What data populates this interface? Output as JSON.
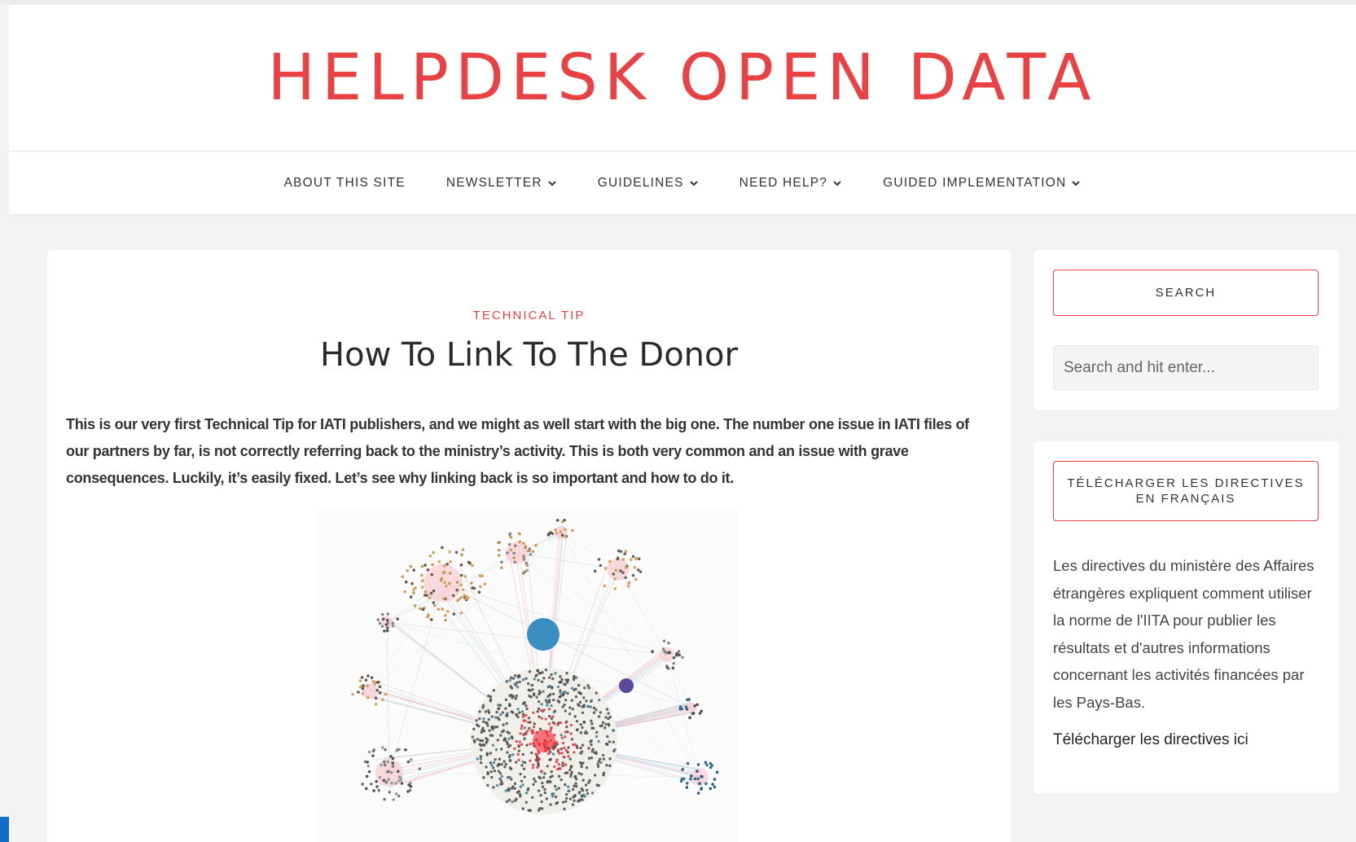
{
  "site": {
    "title": "HELPDESK OPEN DATA",
    "accent_color": "#e84244"
  },
  "nav": {
    "items": [
      {
        "label": "ABOUT THIS SITE",
        "has_dropdown": false
      },
      {
        "label": "NEWSLETTER",
        "has_dropdown": true
      },
      {
        "label": "GUIDELINES",
        "has_dropdown": true
      },
      {
        "label": "NEED HELP?",
        "has_dropdown": true
      },
      {
        "label": "GUIDED IMPLEMENTATION",
        "has_dropdown": true
      }
    ],
    "dropdown_icon": "chevron-down-icon"
  },
  "post": {
    "category": "TECHNICAL TIP",
    "title": "How To Link To The Donor",
    "intro": "This is our very first Technical Tip for IATI publishers, and we might as well start with the big one. The number one issue in IATI files of our partners by far, is not correctly referring back to the ministry’s activity. This is both very common and an issue with grave consequences. Luckily, it’s easily fixed. Let’s see why linking back is so important and how to do it.",
    "image": "network-graph-image"
  },
  "sidebar": {
    "search": {
      "title": "SEARCH",
      "placeholder": "Search and hit enter..."
    },
    "download": {
      "title": "TÉLÉCHARGER LES DIRECTIVES EN FRANÇAIS",
      "text": "Les directives du ministère des Affaires étrangères expliquent comment utiliser la norme de l'IITA pour publier les résultats et d'autres informations concernant les activités financées par les Pays-Bas.",
      "link_label": "Télécharger les directives ici"
    }
  }
}
